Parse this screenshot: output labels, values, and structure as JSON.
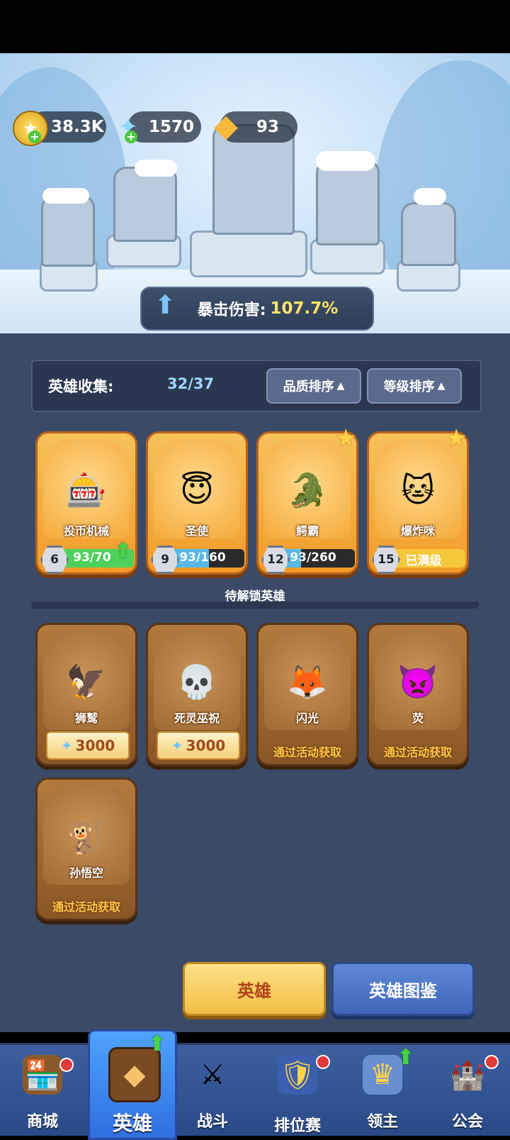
{
  "currencies": [
    {
      "icon": "gold-coin-icon",
      "value": "38.3K"
    },
    {
      "icon": "crystal-icon",
      "value": "1570"
    },
    {
      "icon": "gold-crystal-icon",
      "value": "93"
    }
  ],
  "stat_banner": {
    "label": "暴击伤害:",
    "value": "107.7%"
  },
  "collection": {
    "label": "英雄收集:",
    "count": "32/37",
    "sort_quality": "品质排序",
    "sort_level": "等级排序"
  },
  "owned_heroes": [
    {
      "name": "投币机械",
      "level": "6",
      "progress": "93/70",
      "progress_ratio": 1.0,
      "bar_color": "#4fd05a",
      "upgrade": true,
      "star": false
    },
    {
      "name": "圣使",
      "level": "9",
      "progress": "93/160",
      "progress_ratio": 0.58,
      "bar_color": "#58b9e8",
      "upgrade": false,
      "star": false
    },
    {
      "name": "鳄霸",
      "level": "12",
      "progress": "93/260",
      "progress_ratio": 0.36,
      "bar_color": "#58b9e8",
      "upgrade": false,
      "star": true
    },
    {
      "name": "爆炸咪",
      "level": "15",
      "progress": "已满级",
      "progress_ratio": 1.0,
      "bar_color": "#f5c93c",
      "upgrade": false,
      "star": true
    }
  ],
  "locked_section_title": "待解锁英雄",
  "locked_heroes": [
    {
      "name": "狮鹫",
      "price": "3000"
    },
    {
      "name": "死灵巫祝",
      "price": "3000"
    },
    {
      "name": "闪光",
      "obtain": "通过活动获取"
    },
    {
      "name": "荧",
      "obtain": "通过活动获取"
    },
    {
      "name": "孙悟空",
      "obtain": "通过活动获取"
    }
  ],
  "buttons": {
    "hero": "英雄",
    "codex": "英雄图鉴"
  },
  "nav": [
    {
      "label": "商城",
      "icon": "shop-icon"
    },
    {
      "label": "英雄",
      "icon": "hero-card-icon"
    },
    {
      "label": "战斗",
      "icon": "swords-icon"
    },
    {
      "label": "排位赛",
      "icon": "ranked-shield-icon"
    },
    {
      "label": "领主",
      "icon": "banner-icon"
    },
    {
      "label": "公会",
      "icon": "guild-castle-icon"
    }
  ]
}
